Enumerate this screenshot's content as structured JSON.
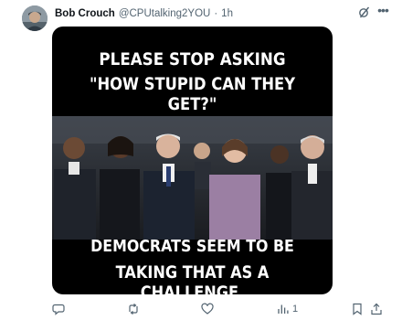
{
  "post": {
    "author_name": "Bob Crouch",
    "author_handle": "@CPUtalking2YOU",
    "separator": "·",
    "time": "1h"
  },
  "meme": {
    "top_line_1": "PLEASE STOP ASKING",
    "top_line_2": "\"HOW STUPID CAN THEY GET?\"",
    "bottom_line_1": "DEMOCRATS SEEM TO BE",
    "bottom_line_2": "TAKING THAT AS A CHALLENGE."
  },
  "actions": {
    "reply_count": "",
    "repost_count": "",
    "like_count": "",
    "views_count": "1",
    "bookmark_icon": "bookmark-icon",
    "share_icon": "share-icon"
  },
  "icons": {
    "grok": "grok-icon",
    "more": "more-icon",
    "reply": "reply-icon",
    "repost": "repost-icon",
    "like": "like-icon",
    "views": "views-icon"
  },
  "colors": {
    "text_primary": "#0f1419",
    "text_secondary": "#536471",
    "background": "#ffffff"
  }
}
